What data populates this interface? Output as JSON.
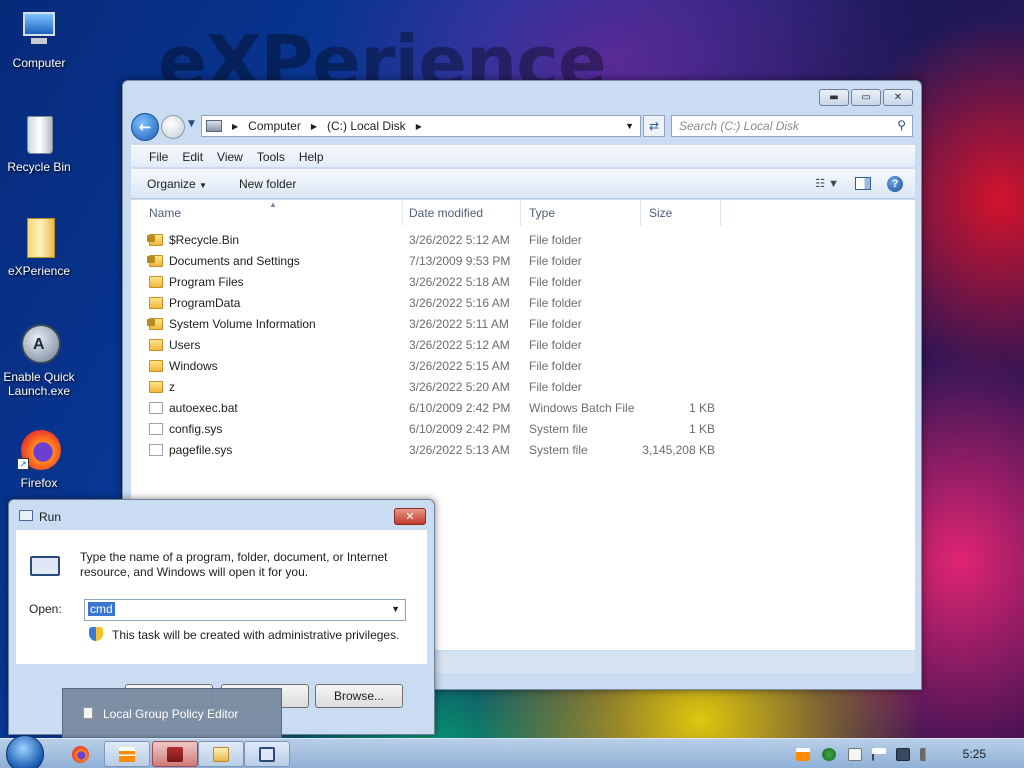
{
  "wallpaper": {
    "text": "eXPerience"
  },
  "desktop": {
    "icons": [
      {
        "label": "Computer"
      },
      {
        "label": "Recycle Bin"
      },
      {
        "label": "eXPerience"
      },
      {
        "label": "Enable Quick Launch.exe"
      },
      {
        "label": "Firefox"
      }
    ]
  },
  "explorer": {
    "address": {
      "parts": [
        "Computer",
        "(C:) Local Disk"
      ]
    },
    "search_placeholder": "Search (C:) Local Disk",
    "menu": [
      "File",
      "Edit",
      "View",
      "Tools",
      "Help"
    ],
    "commands": {
      "organize": "Organize",
      "new_folder": "New folder"
    },
    "columns": {
      "name": "Name",
      "date": "Date modified",
      "type": "Type",
      "size": "Size"
    },
    "files": [
      {
        "name": "$Recycle.Bin",
        "date": "3/26/2022 5:12 AM",
        "type": "File folder",
        "size": ""
      },
      {
        "name": "Documents and Settings",
        "date": "7/13/2009 9:53 PM",
        "type": "File folder",
        "size": ""
      },
      {
        "name": "Program Files",
        "date": "3/26/2022 5:18 AM",
        "type": "File folder",
        "size": ""
      },
      {
        "name": "ProgramData",
        "date": "3/26/2022 5:16 AM",
        "type": "File folder",
        "size": ""
      },
      {
        "name": "System Volume Information",
        "date": "3/26/2022 5:11 AM",
        "type": "File folder",
        "size": ""
      },
      {
        "name": "Users",
        "date": "3/26/2022 5:12 AM",
        "type": "File folder",
        "size": ""
      },
      {
        "name": "Windows",
        "date": "3/26/2022 5:15 AM",
        "type": "File folder",
        "size": ""
      },
      {
        "name": "z",
        "date": "3/26/2022 5:20 AM",
        "type": "File folder",
        "size": ""
      },
      {
        "name": "autoexec.bat",
        "date": "6/10/2009 2:42 PM",
        "type": "Windows Batch File",
        "size": "1 KB"
      },
      {
        "name": "config.sys",
        "date": "6/10/2009 2:42 PM",
        "type": "System file",
        "size": "1 KB"
      },
      {
        "name": "pagefile.sys",
        "date": "3/26/2022 5:13 AM",
        "type": "System file",
        "size": "3,145,208 KB"
      }
    ]
  },
  "run": {
    "title": "Run",
    "description": "Type the name of a program, folder, document, or Internet resource, and Windows will open it for you.",
    "open_label": "Open:",
    "open_value": "cmd",
    "admin_note": "This task will be created with administrative privileges.",
    "browse_label": "Browse..."
  },
  "tooltip": {
    "label": "Local Group Policy Editor"
  },
  "taskbar": {
    "clock": "5:25"
  }
}
